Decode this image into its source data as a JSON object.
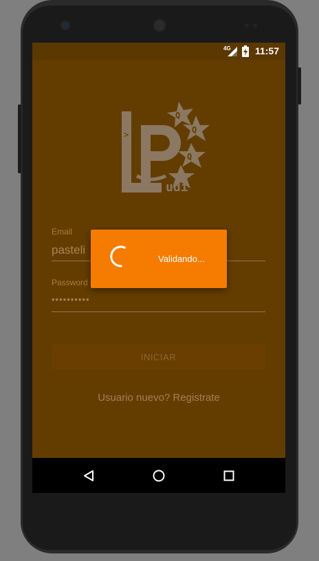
{
  "status_bar": {
    "network": "4G",
    "time": "11:57"
  },
  "logo": {
    "letters": [
      "L",
      "P",
      "Q",
      "Q",
      "Q"
    ],
    "suffix": "udi",
    "prompt": ">"
  },
  "form": {
    "email_label": "Email",
    "email_value": "pasteli",
    "password_label": "Password",
    "password_value": "••••••••••",
    "login_button": "INICIAR",
    "register_link": "Usuario nuevo? Registrate"
  },
  "dialog": {
    "message": "Validando..."
  },
  "nav_bar": {
    "back_icon": "back-triangle-icon",
    "home_icon": "home-circle-icon",
    "recents_icon": "recents-square-icon"
  },
  "colors": {
    "dialog_background": "#f57c00",
    "dimmed_background": "#633d00",
    "nav_bar": "#000000"
  }
}
